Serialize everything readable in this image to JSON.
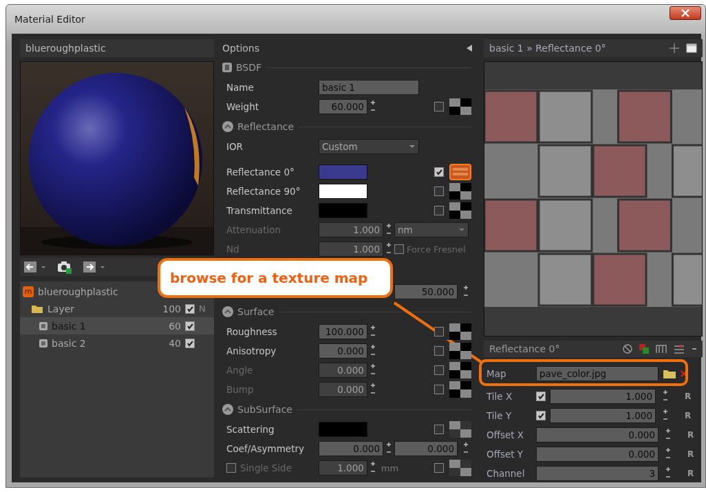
{
  "window": {
    "title": "Material Editor"
  },
  "material": {
    "name": "blueroughplastic"
  },
  "tree": {
    "badge": "m",
    "label": "blueroughplastic",
    "children": [
      {
        "label": "Layer",
        "value": "100",
        "checked": true,
        "flag": "N",
        "children": [
          {
            "label": "basic 1",
            "value": "60",
            "checked": true,
            "selected": true
          },
          {
            "label": "basic 2",
            "value": "40",
            "checked": true,
            "selected": false
          }
        ]
      }
    ]
  },
  "options": {
    "title": "Options",
    "sections": [
      {
        "title": "BSDF",
        "rows": [
          {
            "kind": "text",
            "label": "Name",
            "value": "basic 1",
            "disabled": false
          },
          {
            "kind": "number",
            "label": "Weight",
            "value": "60.000",
            "disabled": false,
            "checked": false,
            "map_linked": false
          }
        ]
      },
      {
        "title": "Reflectance",
        "rows": [
          {
            "kind": "select",
            "label": "IOR",
            "value": "Custom",
            "disabled": false
          },
          {
            "kind": "color",
            "label": "Reflectance 0°",
            "color": "#3a3a8e",
            "disabled": false,
            "checked": true,
            "map_linked": true
          },
          {
            "kind": "color",
            "label": "Reflectance 90°",
            "color": "#ffffff",
            "disabled": false,
            "checked": false,
            "map_linked": false
          },
          {
            "kind": "color",
            "label": "Transmittance",
            "color": "#000000",
            "disabled": false,
            "checked": false,
            "map_linked": false
          },
          {
            "kind": "number",
            "label": "Attenuation",
            "value": "1.000",
            "disabled": true,
            "unit_select": "nm"
          },
          {
            "kind": "number",
            "label": "Nd",
            "value": "1.000",
            "disabled": true,
            "option": {
              "label": "Force Fresnel",
              "checked": false
            }
          },
          {
            "kind": "covered",
            "second": "50.000"
          }
        ]
      },
      {
        "title": "Surface",
        "rows": [
          {
            "kind": "number",
            "label": "Roughness",
            "value": "100.000",
            "disabled": false,
            "checked": false,
            "map_linked": false
          },
          {
            "kind": "number",
            "label": "Anisotropy",
            "value": "0.000",
            "disabled": false,
            "checked": false,
            "map_linked": false
          },
          {
            "kind": "number",
            "label": "Angle",
            "value": "0.000",
            "disabled": true,
            "checked": false,
            "map_linked": false
          },
          {
            "kind": "number",
            "label": "Bump",
            "value": "0.000",
            "disabled": true,
            "checked": false,
            "map_linked": false
          }
        ]
      },
      {
        "title": "SubSurface",
        "rows": [
          {
            "kind": "color",
            "label": "Scattering",
            "color": "#000000",
            "disabled": false,
            "checked": false,
            "map_linked": false
          },
          {
            "kind": "number",
            "label": "Coef/Asymmetry",
            "value": "0.000",
            "second": "0.000",
            "disabled": false
          },
          {
            "kind": "number",
            "label": "Single Side",
            "label_checked": false,
            "value": "1.000",
            "disabled": true,
            "unit": "mm",
            "checked": false,
            "map_linked": false
          }
        ]
      }
    ]
  },
  "map_panel": {
    "breadcrumb": "basic 1 » Reflectance 0°",
    "header": "Reflectance 0°",
    "rows": [
      {
        "kind": "file",
        "label": "Map",
        "value": "pave_color.jpg"
      },
      {
        "kind": "number",
        "label": "Tile X",
        "checked": true,
        "value": "1.000",
        "reset": "R"
      },
      {
        "kind": "number",
        "label": "Tile Y",
        "checked": true,
        "value": "1.000",
        "reset": "R"
      },
      {
        "kind": "number",
        "label": "Offset X",
        "value": "0.000",
        "reset": "R"
      },
      {
        "kind": "number",
        "label": "Offset Y",
        "value": "0.000",
        "reset": "R"
      },
      {
        "kind": "number",
        "label": "Channel",
        "value": "3",
        "reset": "R"
      }
    ]
  },
  "callout": {
    "text": "browse for a texture map"
  }
}
